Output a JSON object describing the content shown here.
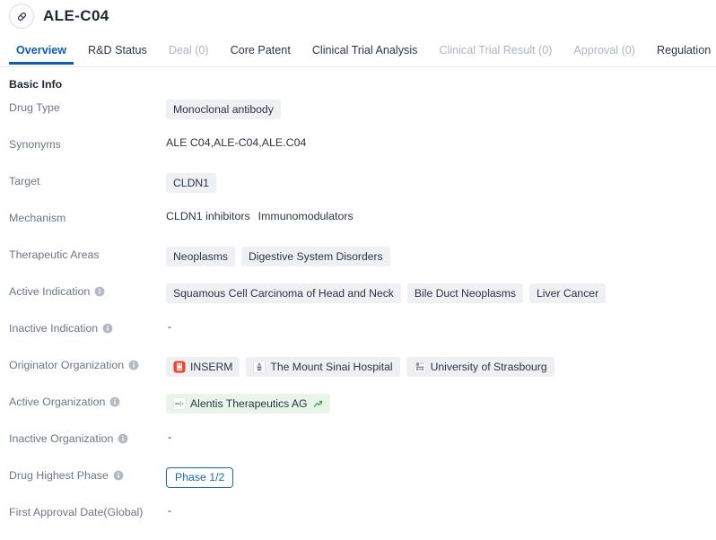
{
  "header": {
    "icon": "pill-capsule-icon",
    "title": "ALE-C04"
  },
  "tabs": [
    {
      "label": "Overview",
      "state": "active"
    },
    {
      "label": "R&D Status",
      "state": "normal"
    },
    {
      "label": "Deal (0)",
      "state": "muted"
    },
    {
      "label": "Core Patent",
      "state": "normal"
    },
    {
      "label": "Clinical Trial Analysis",
      "state": "normal"
    },
    {
      "label": "Clinical Trial Result (0)",
      "state": "muted"
    },
    {
      "label": "Approval (0)",
      "state": "muted"
    },
    {
      "label": "Regulation",
      "state": "normal"
    }
  ],
  "section": {
    "title": "Basic Info"
  },
  "rows": {
    "drug_type": {
      "label": "Drug Type",
      "tags": [
        "Monoclonal antibody"
      ]
    },
    "synonyms": {
      "label": "Synonyms",
      "text": "ALE C04,ALE-C04,ALE.C04"
    },
    "target": {
      "label": "Target",
      "tags": [
        "CLDN1"
      ]
    },
    "mechanism": {
      "label": "Mechanism",
      "items": [
        "CLDN1 inhibitors",
        "Immunomodulators"
      ]
    },
    "therapeutic_areas": {
      "label": "Therapeutic Areas",
      "tags": [
        "Neoplasms",
        "Digestive System Disorders"
      ]
    },
    "active_indication": {
      "label": "Active Indication",
      "has_info": true,
      "tags": [
        "Squamous Cell Carcinoma of Head and Neck",
        "Bile Duct Neoplasms",
        "Liver Cancer"
      ]
    },
    "inactive_indication": {
      "label": "Inactive Indication",
      "has_info": true,
      "empty": "-"
    },
    "originator_organization": {
      "label": "Originator Organization",
      "has_info": true,
      "orgs": [
        {
          "name": "INSERM",
          "logo": "inserm-logo-icon"
        },
        {
          "name": "The Mount Sinai Hospital",
          "logo": "mount-sinai-logo-icon"
        },
        {
          "name": "University of Strasbourg",
          "logo": "strasbourg-logo-icon"
        }
      ]
    },
    "active_organization": {
      "label": "Active Organization",
      "has_info": true,
      "orgs": [
        {
          "name": "Alentis Therapeutics AG",
          "logo": "alentis-logo-icon",
          "trend": "trend-up-icon"
        }
      ]
    },
    "inactive_organization": {
      "label": "Inactive Organization",
      "has_info": true,
      "empty": "-"
    },
    "drug_highest_phase": {
      "label": "Drug Highest Phase",
      "has_info": true,
      "phase": "Phase 1/2"
    },
    "first_approval_date": {
      "label": "First Approval Date(Global)",
      "empty": "-"
    }
  },
  "colors": {
    "accent_blue": "#0b5fb0",
    "phase_blue": "#1769b5",
    "label_gray": "#6b7687",
    "tag_bg": "#eef0f3",
    "tag_green_bg": "#eaf5ea",
    "muted_tab": "#aeb5c0",
    "inserm_red": "#e8452c",
    "trend_green": "#2aa14a"
  }
}
